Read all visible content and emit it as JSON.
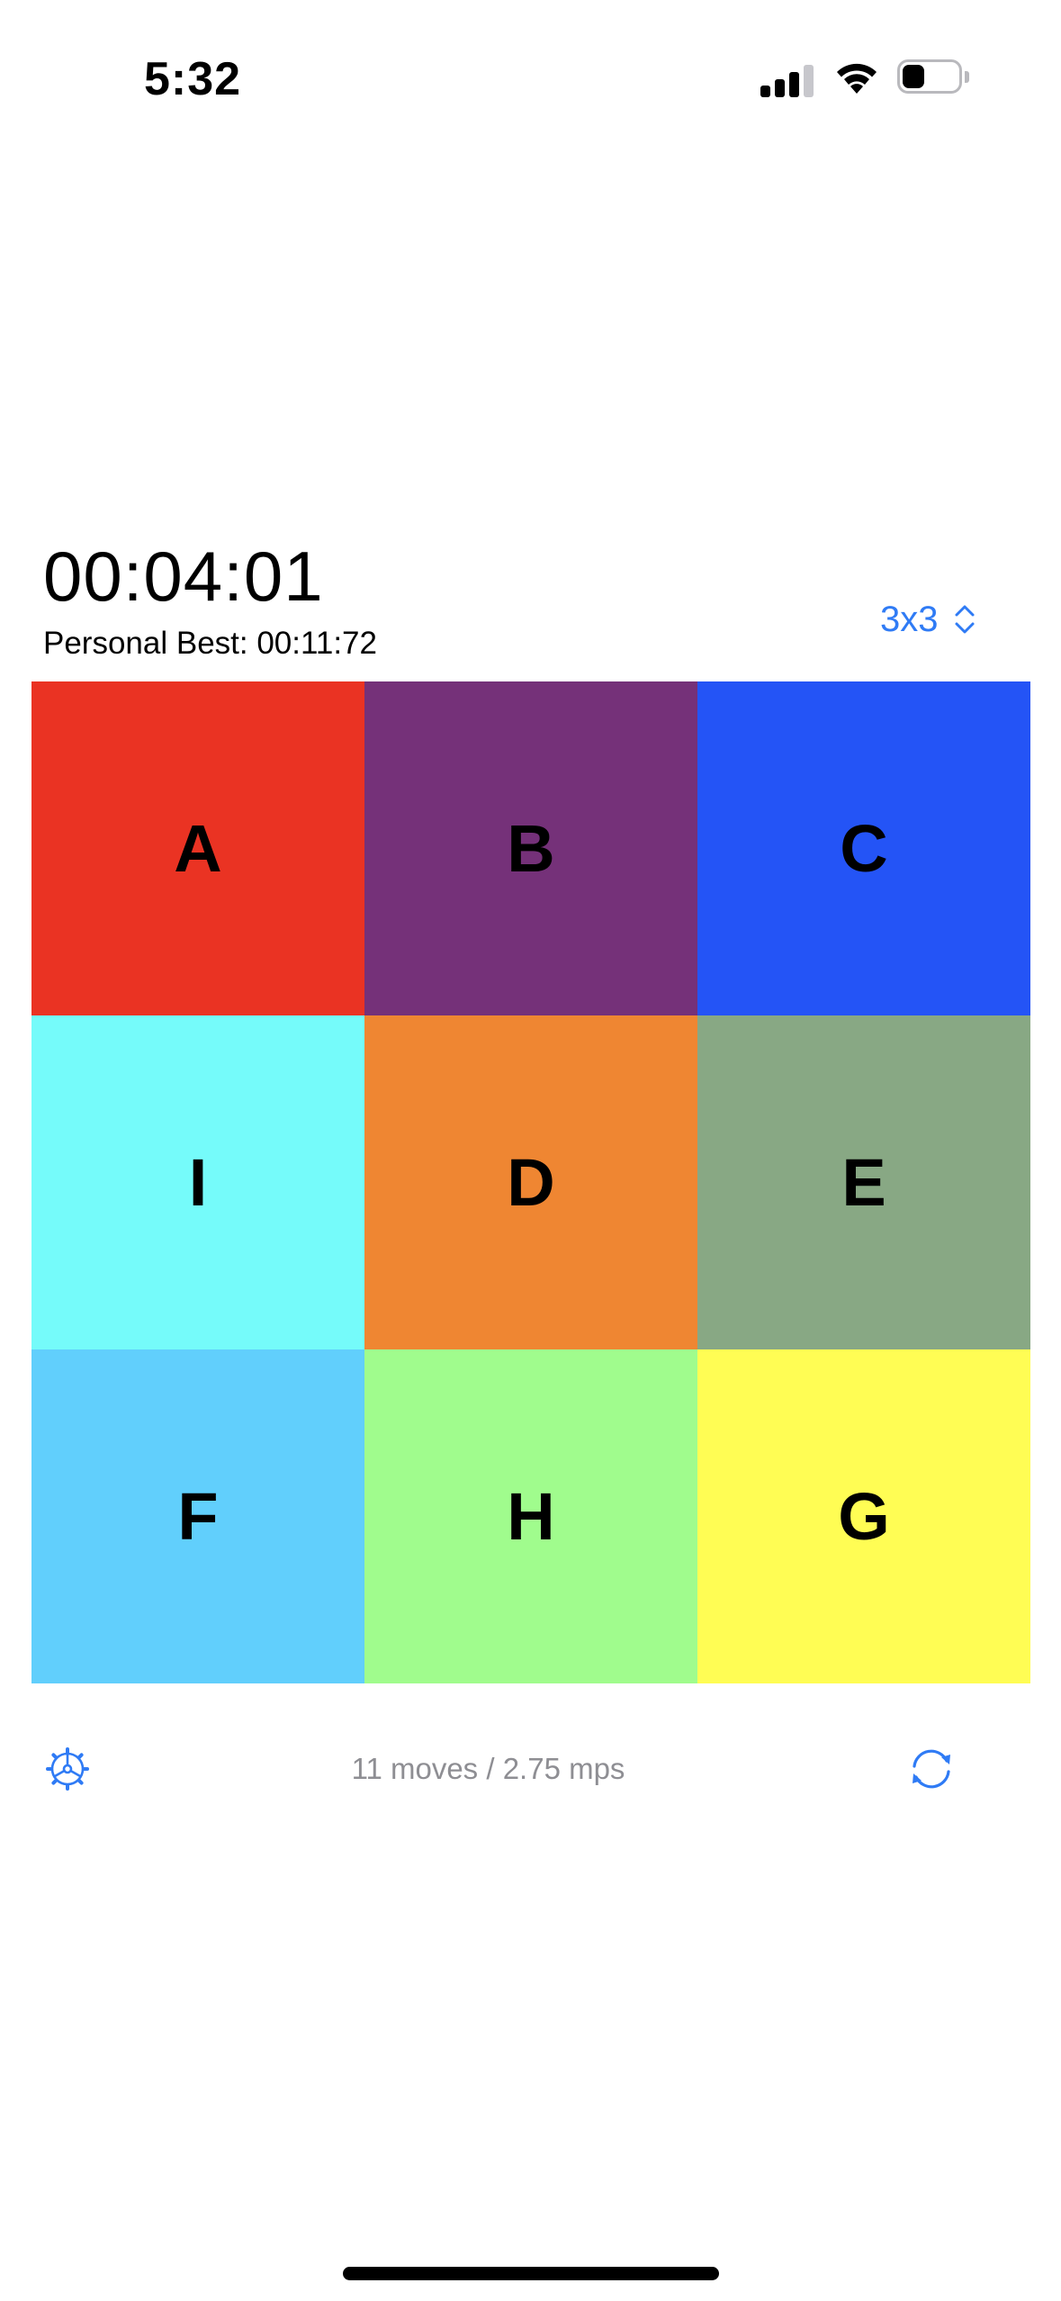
{
  "status_bar": {
    "time": "5:32",
    "battery_level": 0.4
  },
  "header": {
    "timer": "00:04:01",
    "personal_best": "Personal Best: 00:11:72",
    "size_picker_label": "3x3"
  },
  "grid": {
    "tiles": [
      {
        "label": "A",
        "color": "#EA3323"
      },
      {
        "label": "B",
        "color": "#753179"
      },
      {
        "label": "C",
        "color": "#2454F6"
      },
      {
        "label": "I",
        "color": "#75FBFA"
      },
      {
        "label": "D",
        "color": "#EF8632"
      },
      {
        "label": "E",
        "color": "#88A884"
      },
      {
        "label": "F",
        "color": "#61CFFC"
      },
      {
        "label": "H",
        "color": "#A0FC8D"
      },
      {
        "label": "G",
        "color": "#FFFD54"
      }
    ]
  },
  "footer": {
    "stats": "11 moves / 2.75 mps"
  },
  "icons": {
    "settings": "gear-icon",
    "refresh": "refresh-icon",
    "size_picker": "chevron-up-down-icon"
  },
  "colors": {
    "accent": "#2F7BF5",
    "secondary_text": "#8E8E93"
  }
}
